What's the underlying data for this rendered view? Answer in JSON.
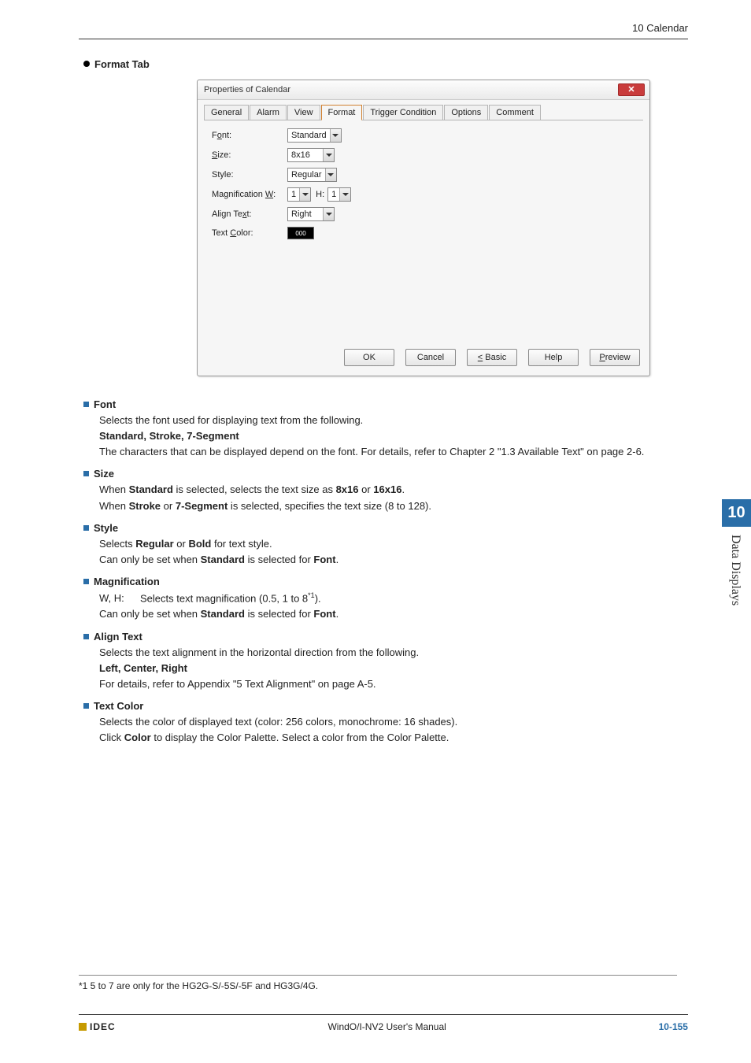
{
  "header": {
    "chapter": "10 Calendar"
  },
  "section": {
    "title": "Format Tab"
  },
  "dialog": {
    "title": "Properties of Calendar",
    "close": "✕",
    "tabs": [
      "General",
      "Alarm",
      "View",
      "Format",
      "Trigger Condition",
      "Options",
      "Comment"
    ],
    "active_tab_index": 3,
    "fields": {
      "font": {
        "label_pre": "F",
        "label_ul": "o",
        "label_post": "nt:",
        "value": "Standard"
      },
      "size": {
        "label_ul": "S",
        "label_post": "ize:",
        "value": "8x16"
      },
      "style": {
        "label": "Style:",
        "value": "Regular"
      },
      "mag": {
        "label_pre": "Magnification ",
        "label_ul": "W",
        "label_post": ":",
        "w": "1",
        "h_label_ul": "H",
        "h_label_post": ":",
        "h": "1"
      },
      "align": {
        "label_pre": "Align Te",
        "label_ul": "x",
        "label_post": "t:",
        "value": "Right"
      },
      "color": {
        "label_pre": "Text ",
        "label_ul": "C",
        "label_post": "olor:",
        "swatch": "000"
      }
    },
    "buttons": {
      "ok": "OK",
      "cancel": "Cancel",
      "basic_ul": "<",
      "basic_post": " Basic",
      "help": "Help",
      "preview_ul": "P",
      "preview_post": "review"
    }
  },
  "desc": {
    "font": {
      "heading": "Font",
      "line1": "Selects the font used for displaying text from the following.",
      "opts": "Standard, Stroke, 7-Segment",
      "line2": "The characters that can be displayed depend on the font. For details, refer to Chapter 2 \"1.3 Available Text\" on page 2-6."
    },
    "size": {
      "heading": "Size",
      "l1a": "When ",
      "l1b": "Standard",
      "l1c": " is selected, selects the text size as ",
      "l1d": "8x16",
      "l1e": " or ",
      "l1f": "16x16",
      "l1g": ".",
      "l2a": "When ",
      "l2b": "Stroke",
      "l2c": " or ",
      "l2d": "7-Segment",
      "l2e": " is selected, specifies the text size (8 to 128)."
    },
    "style": {
      "heading": "Style",
      "l1a": "Selects ",
      "l1b": "Regular",
      "l1c": " or ",
      "l1d": "Bold",
      "l1e": " for text style.",
      "l2a": "Can only be set when ",
      "l2b": "Standard",
      "l2c": " is selected for ",
      "l2d": "Font",
      "l2e": "."
    },
    "mag": {
      "heading": "Magnification",
      "wh_label": "W, H:",
      "wh_text_a": "Selects text magnification (0.5, 1 to 8",
      "wh_sup": "*1",
      "wh_text_b": ").",
      "l2a": "Can only be set when ",
      "l2b": "Standard",
      "l2c": " is selected for ",
      "l2d": "Font",
      "l2e": "."
    },
    "align": {
      "heading": "Align Text",
      "line1": "Selects the text alignment in the horizontal direction from the following.",
      "opts": "Left, Center, Right",
      "line2": "For details, refer to Appendix \"5 Text Alignment\" on page A-5."
    },
    "color": {
      "heading": "Text Color",
      "line1": "Selects the color of displayed text (color: 256 colors, monochrome: 16 shades).",
      "l2a": "Click ",
      "l2b": "Color",
      "l2c": " to display the Color Palette. Select a color from the Color Palette."
    }
  },
  "sidetab": {
    "num": "10",
    "text": "Data Displays"
  },
  "footnote": "*1  5 to 7 are only for the HG2G-S/-5S/-5F and HG3G/4G.",
  "footer": {
    "logo": "IDEC",
    "center": "WindO/I-NV2 User's Manual",
    "page_chap": "10-",
    "page_num": "155"
  }
}
